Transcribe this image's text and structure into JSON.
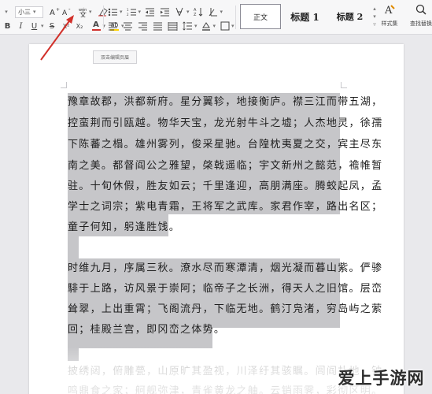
{
  "toolbar": {
    "font_size": "小三",
    "icons": {
      "grow_font": "A⁺",
      "shrink_font": "A⁻",
      "pinyin": "文",
      "clear_format": "eraser",
      "bold": "B",
      "italic": "I",
      "underline": "U",
      "strikethrough": "S",
      "superscript": "X²",
      "subscript": "X₂",
      "font_color": "A",
      "highlight": "ab"
    },
    "font_color": "#d0312d",
    "highlight_color": "#ffd200"
  },
  "styles": {
    "normal": "正文",
    "heading1": "标题 1",
    "heading2": "标题 2"
  },
  "big_buttons": {
    "style_set": "样式集",
    "find_replace": "查找替换"
  },
  "document": {
    "header_tip": "双击编辑页眉",
    "lines": [
      "豫章故郡，洪都新府。星分翼轸，地接衡庐。襟三江而带五湖，",
      "控蛮荆而引瓯越。物华天宝，龙光射牛斗之墟；人杰地灵，徐孺",
      "下陈蕃之榻。雄州雾列，俊采星驰。台隍枕夷夏之交，宾主尽东",
      "南之美。都督阎公之雅望，棨戟遥临；宇文新州之懿范，襜帷暂",
      "驻。十旬休假，胜友如云；千里逢迎，高朋满座。腾蛟起凤，孟",
      "学士之词宗；紫电青霜，王将军之武库。家君作宰，路出名区；",
      "童子何知，躬逢胜饯。",
      "",
      "时维九月，序属三秋。潦水尽而寒潭清，烟光凝而暮山紫。俨骖",
      "騑于上路，访风景于崇阿；临帝子之长洲，得天人之旧馆。层峦",
      "耸翠，上出重霄；飞阁流丹，下临无地。鹤汀凫渚，穷岛屿之萦",
      "回；桂殿兰宫，即冈峦之体势。",
      "",
      "披绣闼，俯雕甍，山原旷其盈视，川泽纡其骇瞩。闾阎扑地，钟",
      "鸣鼎食之家；舸舰弥津，青雀黄龙之舳。云销雨霁，彩彻区明。"
    ]
  },
  "watermark": "爱上手游网",
  "colors": {
    "selection": "#c6c6c9",
    "annotation_arrow": "#d2302a",
    "page": "#ffffff",
    "canvas": "#e9e9ec"
  }
}
